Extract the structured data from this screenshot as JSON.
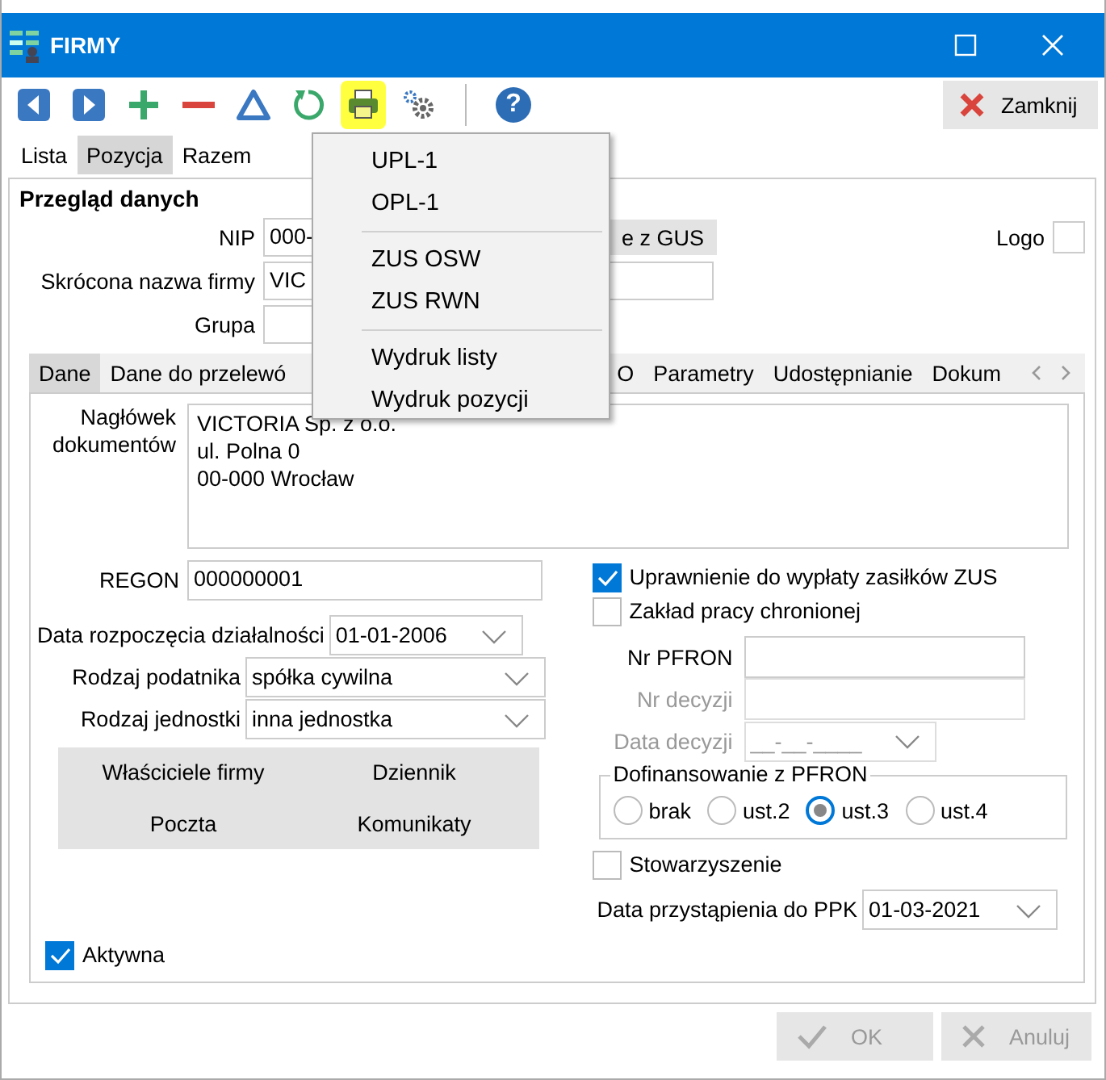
{
  "window": {
    "title": "FIRMY"
  },
  "toolbar": {
    "buttons": [
      {
        "kind": "prev",
        "selected": false
      },
      {
        "kind": "next",
        "selected": false
      },
      {
        "kind": "add",
        "selected": false
      },
      {
        "kind": "remove",
        "selected": false
      },
      {
        "kind": "delta",
        "selected": false
      },
      {
        "kind": "refresh",
        "selected": false
      },
      {
        "kind": "print",
        "selected": true
      },
      {
        "kind": "gears",
        "selected": false
      },
      {
        "kind": "separator"
      },
      {
        "kind": "help",
        "glyph": "?",
        "selected": false
      }
    ],
    "close_button": {
      "label": "Zamknij"
    }
  },
  "view_tabs": [
    {
      "label": "Lista",
      "selected": false
    },
    {
      "label": "Pozycja",
      "selected": true
    },
    {
      "label": "Razem",
      "selected": false
    }
  ],
  "print_menu": {
    "groups": [
      [
        "UPL-1",
        "OPL-1"
      ],
      [
        "ZUS OSW",
        "ZUS RWN"
      ],
      [
        "Wydruk listy",
        "Wydruk pozycji"
      ]
    ]
  },
  "overview": {
    "title": "Przegląd danych",
    "nip": {
      "label": "NIP",
      "value": "000-"
    },
    "gus_button": {
      "label": "e z GUS"
    },
    "short_name": {
      "label": "Skrócona nazwa firmy",
      "value": "VIC"
    },
    "group": {
      "label": "Grupa"
    },
    "logo": {
      "label": "Logo"
    }
  },
  "detail_tabs": [
    {
      "label": "Dane",
      "selected": true
    },
    {
      "label": "Dane do przelewó",
      "selected": false
    },
    {
      "label": "O",
      "selected": false
    },
    {
      "label": "Parametry",
      "selected": false
    },
    {
      "label": "Udostępnianie",
      "selected": false
    },
    {
      "label": "Dokum",
      "selected": false
    }
  ],
  "dane": {
    "header": {
      "label": "Nagłówek dokumentów",
      "lines": [
        "VICTORIA Sp. z o.o.",
        "ul. Polna 0",
        "00-000 Wrocław"
      ]
    },
    "regon": {
      "label": "REGON",
      "value": "000000001"
    },
    "start_date": {
      "label": "Data rozpoczęcia działalności",
      "value": "01-01-2006"
    },
    "taxpayer_type": {
      "label": "Rodzaj podatnika",
      "value": "spółka cywilna"
    },
    "unit_type": {
      "label": "Rodzaj jednostki",
      "value": "inna jednostka"
    },
    "link_buttons": [
      "Właściciele firmy",
      "Dziennik",
      "Poczta",
      "Komunikaty"
    ],
    "checks": [
      {
        "label": "Uprawnienie do wypłaty zasiłków ZUS",
        "checked": true
      },
      {
        "label": "Zakład pracy chronionej",
        "checked": false
      }
    ],
    "pfron_fields": [
      {
        "kind": "text",
        "label": "Nr PFRON",
        "disabled": false
      },
      {
        "kind": "text",
        "label": "Nr decyzji",
        "disabled": true
      },
      {
        "kind": "date",
        "label": "Data decyzji",
        "value": "__-__-____",
        "disabled": true
      }
    ],
    "funding": {
      "legend": "Dofinansowanie z PFRON",
      "options": [
        {
          "label": "brak",
          "selected": false
        },
        {
          "label": "ust.2",
          "selected": false
        },
        {
          "label": "ust.3",
          "selected": true
        },
        {
          "label": "ust.4",
          "selected": false
        }
      ]
    },
    "association": {
      "label": "Stowarzyszenie",
      "checked": false
    },
    "ppk_date": {
      "label": "Data przystąpienia do PPK",
      "value": "01-03-2021"
    }
  },
  "active": {
    "label": "Aktywna",
    "checked": true
  },
  "footer_buttons": [
    {
      "kind": "ok",
      "label": "OK",
      "disabled": true
    },
    {
      "kind": "cancel",
      "label": "Anuluj",
      "disabled": true
    }
  ]
}
